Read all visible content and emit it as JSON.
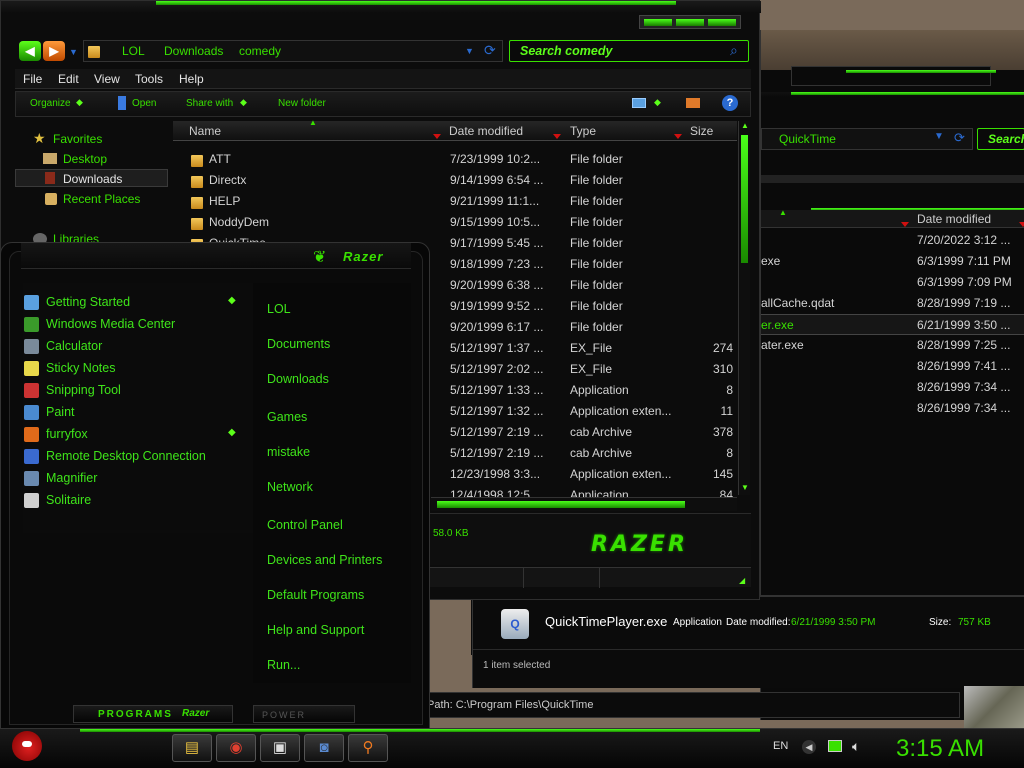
{
  "explorer": {
    "breadcrumb": [
      "LOL",
      "Downloads",
      "comedy"
    ],
    "search_placeholder": "Search comedy",
    "menu": [
      "File",
      "Edit",
      "View",
      "Tools",
      "Help"
    ],
    "toolbar": {
      "organize": "Organize",
      "open": "Open",
      "share": "Share with",
      "new_folder": "New folder"
    },
    "nav": {
      "favorites": "Favorites",
      "desktop": "Desktop",
      "downloads": "Downloads",
      "recent": "Recent Places",
      "libraries": "Libraries"
    },
    "columns": {
      "name": "Name",
      "date": "Date modified",
      "type": "Type",
      "size": "Size"
    },
    "rows": [
      {
        "name": "ATT",
        "date": "7/23/1999 10:2...",
        "type": "File folder",
        "size": ""
      },
      {
        "name": "Directx",
        "date": "9/14/1999 6:54 ...",
        "type": "File folder",
        "size": ""
      },
      {
        "name": "HELP",
        "date": "9/21/1999 11:1...",
        "type": "File folder",
        "size": ""
      },
      {
        "name": "NoddyDem",
        "date": "9/15/1999 10:5...",
        "type": "File folder",
        "size": ""
      },
      {
        "name": "QuickTime",
        "date": "9/17/1999 5:45 ...",
        "type": "File folder",
        "size": ""
      },
      {
        "name": "",
        "date": "9/18/1999 7:23 ...",
        "type": "File folder",
        "size": ""
      },
      {
        "name": "",
        "date": "9/20/1999 6:38 ...",
        "type": "File folder",
        "size": ""
      },
      {
        "name": "",
        "date": "9/19/1999 9:52 ...",
        "type": "File folder",
        "size": ""
      },
      {
        "name": "",
        "date": "9/20/1999 6:17 ...",
        "type": "File folder",
        "size": ""
      },
      {
        "name": "",
        "date": "5/12/1997 1:37 ...",
        "type": "EX_File",
        "size": "274"
      },
      {
        "name": "",
        "date": "5/12/1997 2:02 ...",
        "type": "EX_File",
        "size": "310"
      },
      {
        "name": "",
        "date": "5/12/1997 1:33 ...",
        "type": "Application",
        "size": "8"
      },
      {
        "name": "",
        "date": "5/12/1997 1:32 ...",
        "type": "Application exten...",
        "size": "11"
      },
      {
        "name": "",
        "date": "5/12/1997 2:19 ...",
        "type": "cab Archive",
        "size": "378"
      },
      {
        "name": "",
        "date": "5/12/1997 2:19 ...",
        "type": "cab Archive",
        "size": "8"
      },
      {
        "name": "",
        "date": "12/23/1998 3:3...",
        "type": "Application exten...",
        "size": "145"
      },
      {
        "name": "",
        "date": "12/4/1998 12:5...",
        "type": "Application",
        "size": "84"
      }
    ],
    "status_size": "58.0 KB",
    "brand": "RAZER"
  },
  "explorer2": {
    "breadcrumb": "QuickTime",
    "search": "Search",
    "date_header": "Date modified",
    "rows": [
      {
        "name": "",
        "date": "7/20/2022 3:12 ..."
      },
      {
        "name": "exe",
        "date": "6/3/1999 7:11 PM"
      },
      {
        "name": "",
        "date": "6/3/1999 7:09 PM"
      },
      {
        "name": "allCache.qdat",
        "date": "8/28/1999 7:19 ..."
      },
      {
        "name": "er.exe",
        "date": "6/21/1999 3:50 ..."
      },
      {
        "name": "ater.exe",
        "date": "8/28/1999 7:25 ..."
      },
      {
        "name": "",
        "date": "8/26/1999 7:41 ..."
      },
      {
        "name": "",
        "date": "8/26/1999 7:34 ..."
      },
      {
        "name": "",
        "date": "8/26/1999 7:34 ..."
      }
    ],
    "details": {
      "filename": "QuickTimePlayer.exe",
      "kind": "Application",
      "date_label": "Date modified:",
      "date_value": "6/21/1999 3:50 PM",
      "size_label": "Size:",
      "size_value": "757 KB"
    },
    "selected": "1 item selected",
    "path": "Path: C:\\Program Files\\QuickTime"
  },
  "start_menu": {
    "brand": "Razer",
    "programs": [
      {
        "label": "Getting Started",
        "icon": "getting-started-icon",
        "color": "#5aa0e0"
      },
      {
        "label": "Windows Media Center",
        "icon": "media-center-icon",
        "color": "#3a9a2a"
      },
      {
        "label": "Calculator",
        "icon": "calculator-icon",
        "color": "#7a8a9a"
      },
      {
        "label": "Sticky Notes",
        "icon": "sticky-notes-icon",
        "color": "#e8d84a"
      },
      {
        "label": "Snipping Tool",
        "icon": "scissors-icon",
        "color": "#cc3333"
      },
      {
        "label": "Paint",
        "icon": "paint-icon",
        "color": "#4a8ad0"
      },
      {
        "label": "furryfox",
        "icon": "firefox-icon",
        "color": "#e06a1a"
      },
      {
        "label": "Remote Desktop Connection",
        "icon": "remote-desktop-icon",
        "color": "#3a6ad0"
      },
      {
        "label": "Magnifier",
        "icon": "magnifier-icon",
        "color": "#6a8ab0"
      },
      {
        "label": "Solitaire",
        "icon": "cards-icon",
        "color": "#d0d0d0"
      }
    ],
    "places": [
      "LOL",
      "Documents",
      "Downloads",
      "Games",
      "mistake",
      "Network",
      "Control Panel",
      "Devices and Printers",
      "Default Programs",
      "Help and Support",
      "Run..."
    ],
    "programs_button": "PROGRAMS",
    "razer_button": "Razer",
    "power_button": "POWER"
  },
  "taskbar": {
    "lang": "EN",
    "clock": "3:15 AM"
  }
}
